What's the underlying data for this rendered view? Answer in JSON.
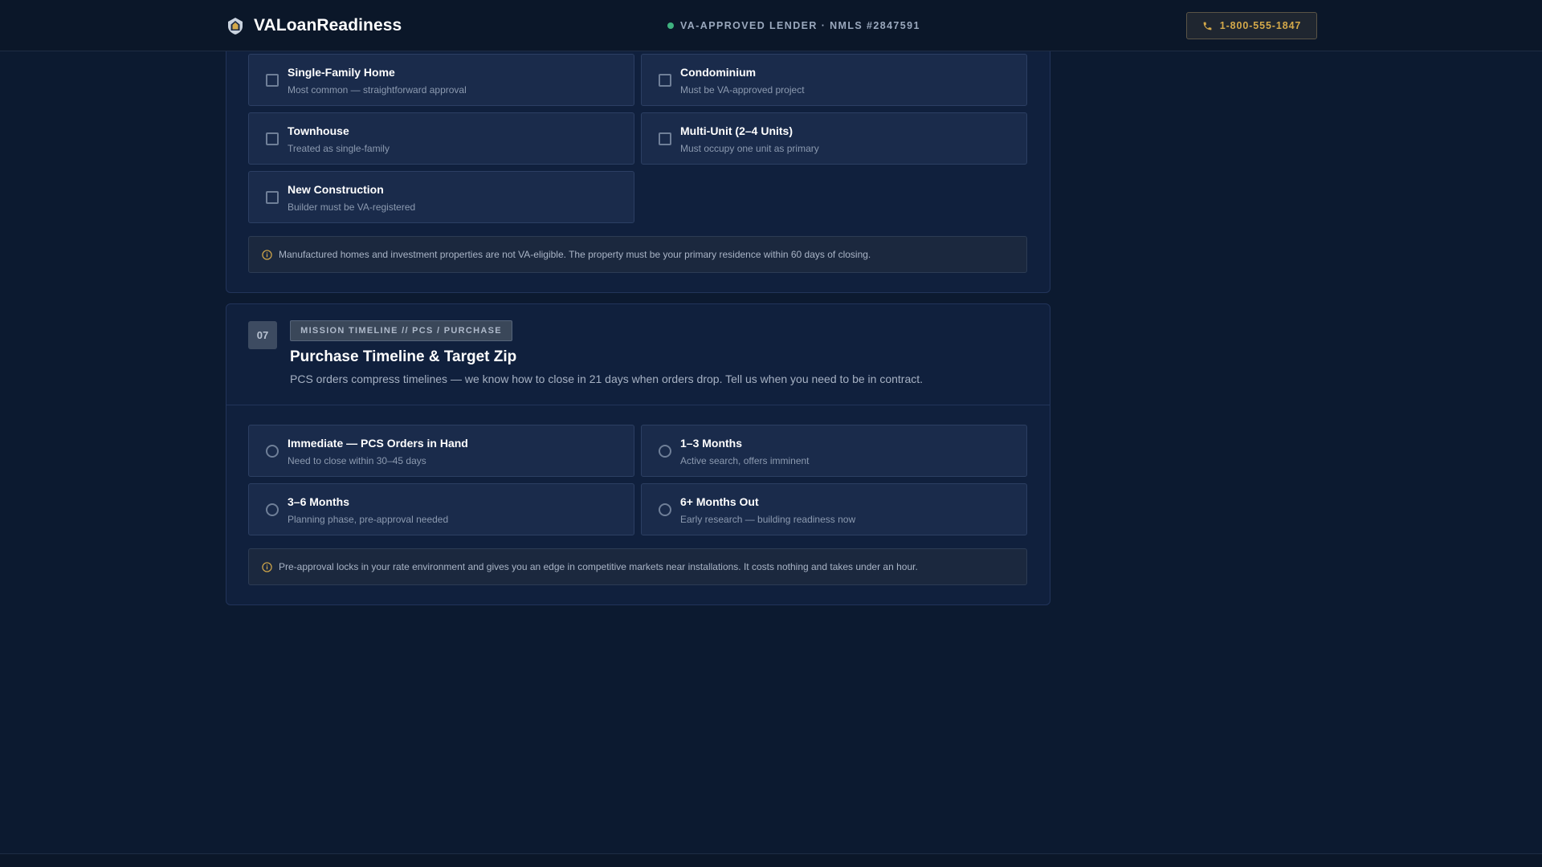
{
  "header": {
    "brand_name": "VALoanReadiness",
    "brand_icon": "shield-house-icon",
    "lender_status": "VA-APPROVED LENDER · NMLS #2847591",
    "status_color": "#3fb27f",
    "phone_label": "1-800-555-1847",
    "phone_icon": "phone-icon",
    "accent_color": "#d4a94a"
  },
  "property_section": {
    "options": [
      {
        "title": "Single-Family Home",
        "subtitle": "Most common — straightforward approval",
        "checked": false
      },
      {
        "title": "Condominium",
        "subtitle": "Must be VA-approved project",
        "checked": false
      },
      {
        "title": "Townhouse",
        "subtitle": "Treated as single-family",
        "checked": false
      },
      {
        "title": "Multi-Unit (2–4 Units)",
        "subtitle": "Must occupy one unit as primary",
        "checked": false
      },
      {
        "title": "New Construction",
        "subtitle": "Builder must be VA-registered",
        "checked": false
      }
    ],
    "note": "Manufactured homes and investment properties are not VA-eligible. The property must be your primary residence within 60 days of closing."
  },
  "timeline_section": {
    "number": "07",
    "tag": "MISSION TIMELINE // PCS / PURCHASE",
    "title": "Purchase Timeline & Target Zip",
    "description": "PCS orders compress timelines — we know how to close in 21 days when orders drop. Tell us when you need to be in contract.",
    "options": [
      {
        "title": "Immediate — PCS Orders in Hand",
        "subtitle": "Need to close within 30–45 days",
        "selected": false
      },
      {
        "title": "1–3 Months",
        "subtitle": "Active search, offers imminent",
        "selected": false
      },
      {
        "title": "3–6 Months",
        "subtitle": "Planning phase, pre-approval needed",
        "selected": false
      },
      {
        "title": "6+ Months Out",
        "subtitle": "Early research — building readiness now",
        "selected": false
      }
    ],
    "note": "Pre-approval locks in your rate environment and gives you an edge in competitive markets near installations. It costs nothing and takes under an hour."
  }
}
